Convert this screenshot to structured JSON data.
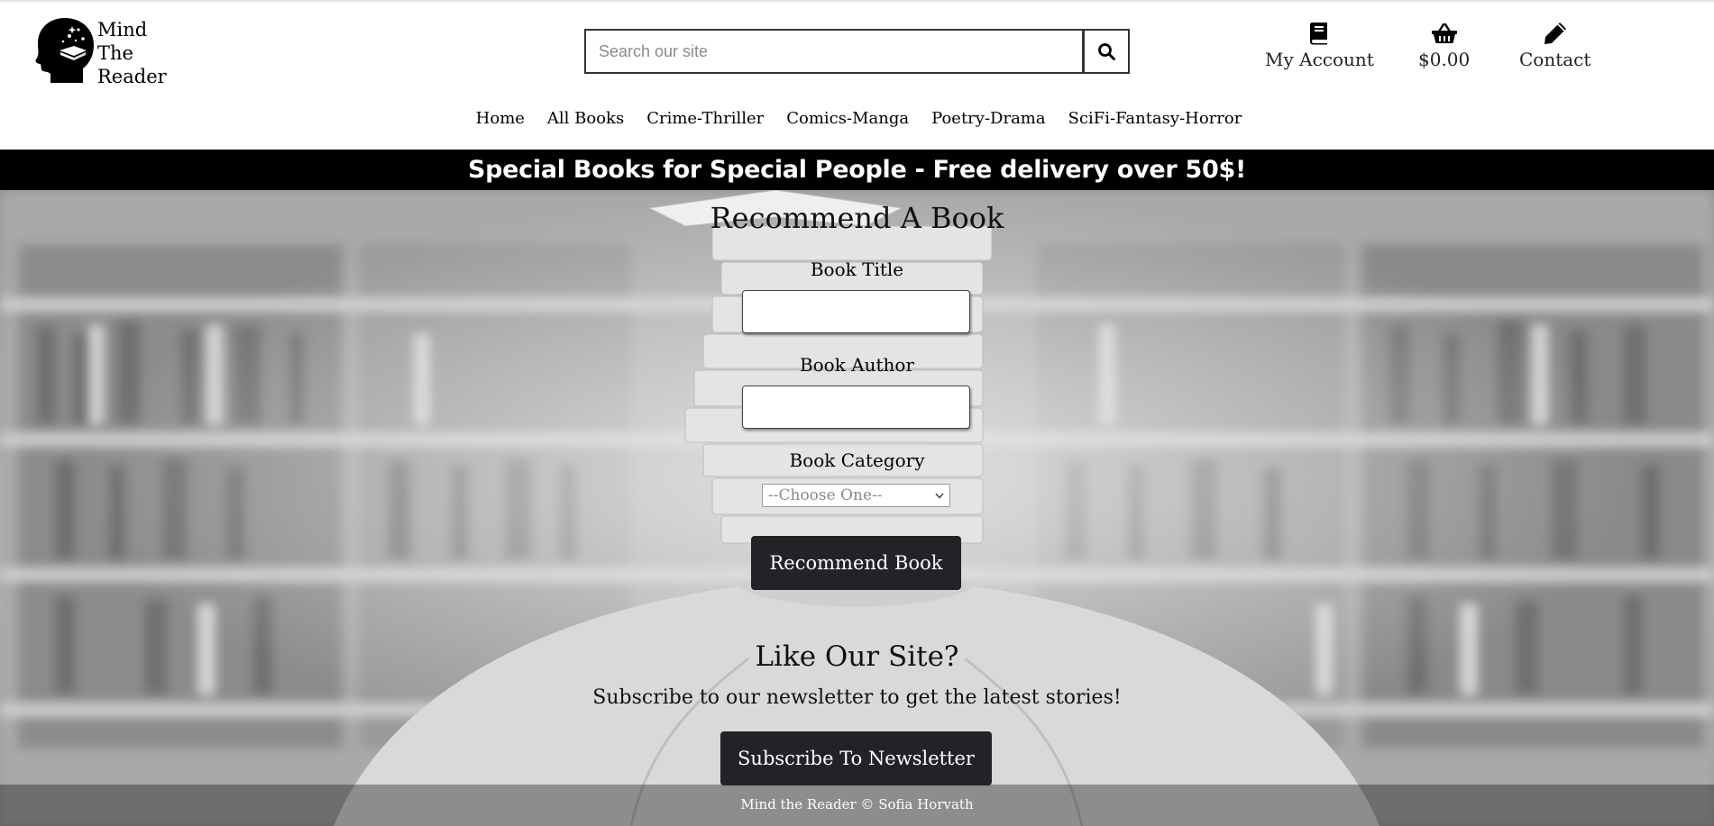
{
  "header": {
    "logo": {
      "line1": "Mind",
      "line2": "The",
      "line3": "Reader",
      "icon": "head-book-icon"
    },
    "search": {
      "placeholder": "Search our site",
      "value": "",
      "icon": "search-icon"
    },
    "account": {
      "label": "My Account",
      "icon": "book-icon"
    },
    "basket": {
      "label": "$0.00",
      "icon": "basket-icon"
    },
    "contact": {
      "label": "Contact",
      "icon": "pencil-icon"
    }
  },
  "nav": {
    "items": [
      {
        "label": "Home"
      },
      {
        "label": "All Books"
      },
      {
        "label": "Crime-Thriller"
      },
      {
        "label": "Comics-Manga"
      },
      {
        "label": "Poetry-Drama"
      },
      {
        "label": "SciFi-Fantasy-Horror"
      }
    ]
  },
  "banner": {
    "text": "Special Books for Special People - Free delivery over 50$!"
  },
  "form": {
    "title": "Recommend A Book",
    "book_title_label": "Book Title",
    "book_title_value": "",
    "book_author_label": "Book Author",
    "book_author_value": "",
    "book_category_label": "Book Category",
    "book_category_selected": "--Choose One--",
    "submit_label": "Recommend Book"
  },
  "newsletter": {
    "title": "Like Our Site?",
    "text": "Subscribe to our newsletter to get the latest stories!",
    "button_label": "Subscribe To Newsletter"
  },
  "footer": {
    "text": "Mind the Reader © Sofia Horvath"
  },
  "colors": {
    "banner_bg": "#000000",
    "button_bg": "#222326",
    "text": "#111111"
  }
}
